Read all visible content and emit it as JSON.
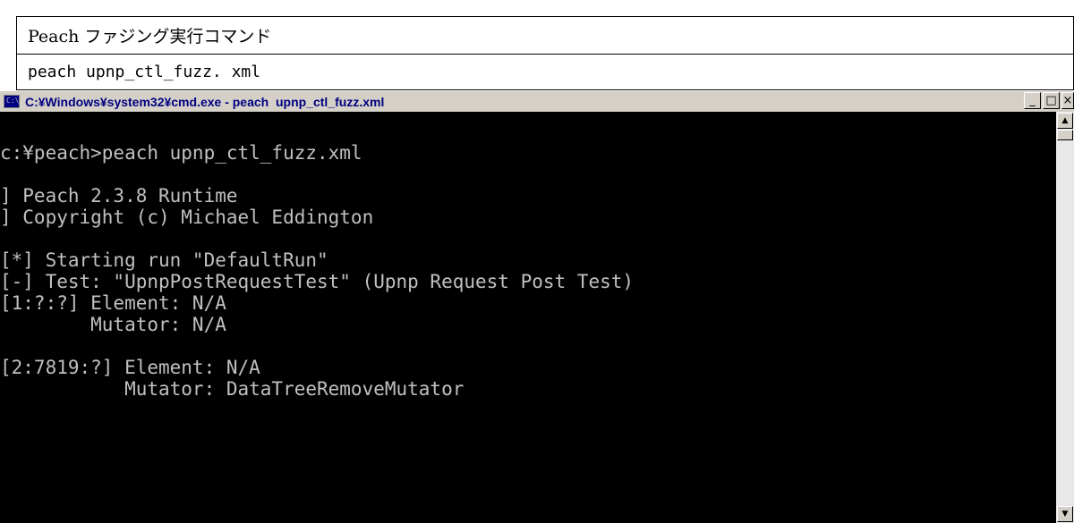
{
  "document": {
    "title": "Peach ファジング実行コマンド",
    "command": "peach upnp_ctl_fuzz. xml"
  },
  "window": {
    "title": "C:¥Windows¥system32¥cmd.exe - peach  upnp_ctl_fuzz.xml",
    "icon": "cmd-icon",
    "icon_text": "C:\\",
    "buttons": {
      "minimize": "_",
      "maximize": "□",
      "close": "×"
    }
  },
  "console": {
    "lines": [
      "",
      "c:¥peach>peach upnp_ctl_fuzz.xml",
      "",
      "] Peach 2.3.8 Runtime",
      "] Copyright (c) Michael Eddington",
      "",
      "[*] Starting run \"DefaultRun\"",
      "[-] Test: \"UpnpPostRequestTest\" (Upnp Request Post Test)",
      "[1:?:?] Element: N/A",
      "        Mutator: N/A",
      "",
      "[2:7819:?] Element: N/A",
      "           Mutator: DataTreeRemoveMutator"
    ]
  },
  "colors": {
    "console_background": "#000000",
    "console_text": "#c0c0c0",
    "titlebar": "#d4d0c8",
    "title_text": "#000080"
  }
}
